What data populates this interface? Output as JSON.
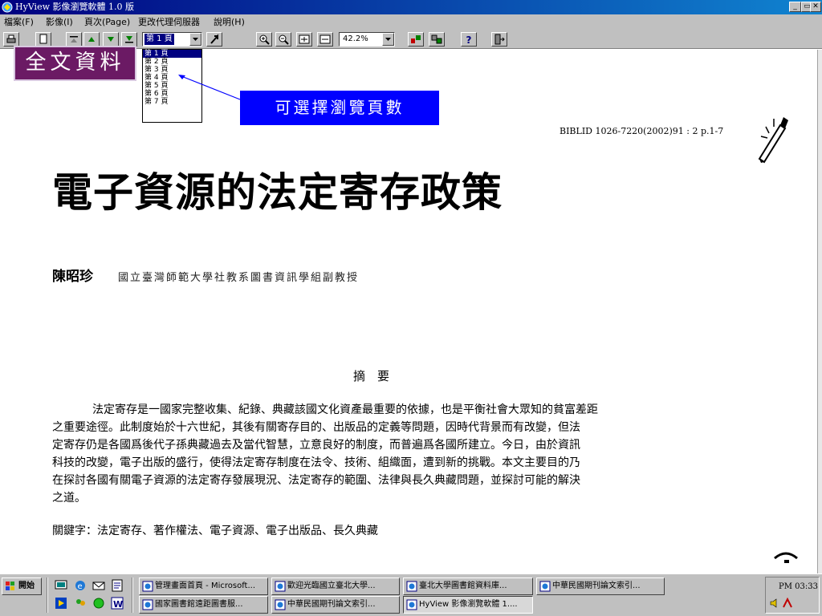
{
  "window": {
    "title": "HyView 影像瀏覽軟體 1.0 版",
    "controls": [
      "_",
      "▭",
      "✕"
    ]
  },
  "menu": [
    "檔案(F)",
    "影像(I)",
    "頁次(Page)",
    "更改代理伺服器",
    "說明(H)"
  ],
  "toolbar": {
    "page_select": "第 1 頁",
    "zoom_select": "42.2%"
  },
  "page_dropdown": {
    "options": [
      "第 1 頁",
      "第 2 頁",
      "第 3 頁",
      "第 4 頁",
      "第 5 頁",
      "第 6 頁",
      "第 7 頁"
    ],
    "selected_index": 0
  },
  "overlays": {
    "fulltext_label": "全文資料",
    "callout_label": "可選擇瀏覽頁數"
  },
  "document": {
    "biblid": "BIBLID 1026-7220(2002)91 : 2 p.1-7",
    "title": "電子資源的法定寄存政策",
    "author": "陳昭珍",
    "affiliation": "國立臺灣師範大學社教系圖書資訊學組副教授",
    "abstract_heading": "摘　要",
    "abstract_lines": [
      "法定寄存是一國家完整收集、紀錄、典藏該國文化資產最重要的依據，也是平衡社會大眾知的貧富差距",
      "之重要途徑。此制度始於十六世紀，其後有關寄存目的、出版品的定義等問題，因時代背景而有改變，但法",
      "定寄存仍是各國爲後代子孫典藏過去及當代智慧，立意良好的制度，而普遍爲各國所建立。今日，由於資訊",
      "科技的改變，電子出版的盛行，使得法定寄存制度在法令、技術、組織面，遭到新的挑戰。本文主要目的乃",
      "在探討各國有關電子資源的法定寄存發展現況、法定寄存的範圍、法律與長久典藏問題，並探討可能的解決",
      "之道。"
    ],
    "keywords": "關鍵字：法定寄存、著作權法、電子資源、電子出版品、長久典藏"
  },
  "taskbar": {
    "start": "開始",
    "tasks_row1": [
      "管理畫面首頁 - Microsoft...",
      "歡迎光臨國立臺北大學...",
      "臺北大學圖書館資料庫...",
      "中華民國期刊論文索引..."
    ],
    "tasks_row2": [
      "國家圖書館遠距圖書服...",
      "中華民國期刊論文索引...",
      "HyView 影像瀏覽軟體 1...."
    ],
    "clock": "PM 03:33"
  },
  "colors": {
    "titlebar": "#000080",
    "fulltext_label_bg": "#6b1a64",
    "callout_bg": "#0000ff",
    "selection": "#000080"
  }
}
